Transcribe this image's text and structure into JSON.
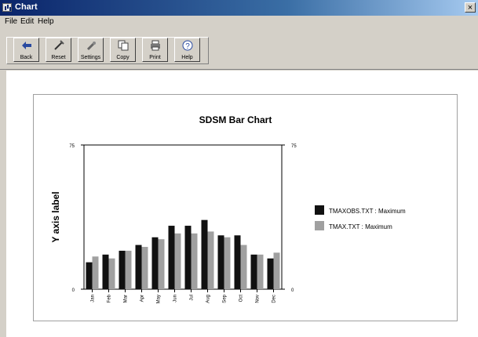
{
  "window": {
    "title": "Chart",
    "close_glyph": "×"
  },
  "menu": [
    {
      "label": "File"
    },
    {
      "label": "Edit"
    },
    {
      "label": "Help"
    }
  ],
  "toolbar": {
    "buttons": [
      {
        "label": "Back",
        "icon": "back-arrow-icon"
      },
      {
        "label": "Reset",
        "icon": "reset-icon"
      },
      {
        "label": "Settings",
        "icon": "settings-icon"
      },
      {
        "label": "Copy",
        "icon": "copy-icon"
      },
      {
        "label": "Print",
        "icon": "printer-icon"
      },
      {
        "label": "Help",
        "icon": "help-icon"
      }
    ]
  },
  "colors": {
    "series1": "#111111",
    "series2": "#a0a0a0",
    "title_bar": "#0a246a"
  },
  "chart_data": {
    "type": "bar",
    "title": "SDSM Bar Chart",
    "ylabel": "Y axis label",
    "xlabel": "",
    "ylim": [
      0,
      75
    ],
    "y_ticks": [
      "0",
      "75"
    ],
    "right_y_ticks": [
      "0",
      "75"
    ],
    "categories": [
      "Jan",
      "Feb",
      "Mar",
      "Apr",
      "May",
      "Jun",
      "Jul",
      "Aug",
      "Sep",
      "Oct",
      "Nov",
      "Dec"
    ],
    "series": [
      {
        "name": "TMAXOBS.TXT : Maximum",
        "values": [
          14,
          18,
          20,
          23,
          27,
          33,
          33,
          36,
          28,
          28,
          18,
          16
        ]
      },
      {
        "name": "TMAX.TXT : Maximum",
        "values": [
          17,
          16,
          20,
          22,
          26,
          29,
          29,
          30,
          27,
          23,
          18,
          19
        ]
      }
    ],
    "legend_position": "right",
    "grid": false
  }
}
